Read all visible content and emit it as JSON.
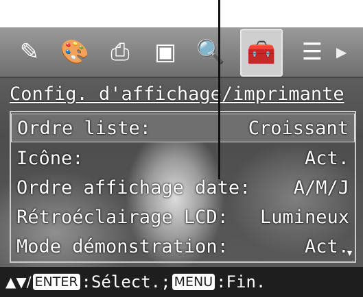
{
  "annotation": {
    "top_label": ""
  },
  "tabs": [
    {
      "icon": "edit-icon",
      "glyph": "✎",
      "active": false
    },
    {
      "icon": "palette-icon",
      "glyph": "🎨",
      "active": false
    },
    {
      "icon": "print-icon",
      "glyph": "⎙",
      "active": false
    },
    {
      "icon": "slideshow-icon",
      "glyph": "▣",
      "active": false
    },
    {
      "icon": "search-file-icon",
      "glyph": "🔍",
      "active": false
    },
    {
      "icon": "toolbox-icon",
      "glyph": "🧰",
      "active": true
    },
    {
      "icon": "list-icon",
      "glyph": "☰",
      "active": false
    }
  ],
  "tab_arrow": "▶",
  "menu": {
    "title": "Config. d'affichage/imprimante",
    "items": [
      {
        "label": "Ordre liste:",
        "value": "Croissant",
        "selected": true
      },
      {
        "label": "Icône:",
        "value": "Act.",
        "selected": false
      },
      {
        "label": "Ordre affichage date:",
        "value": "A/M/J",
        "selected": false
      },
      {
        "label": "Rétroéclairage LCD:",
        "value": "Lumineux",
        "selected": false
      },
      {
        "label": "Mode démonstration:",
        "value": "Act.",
        "selected": false
      }
    ],
    "scroll_indicator": "▾"
  },
  "bottom_bar": {
    "arrows": "▲▼/",
    "enter_key": "ENTER",
    "select_text": ":Sélect.; ",
    "menu_key": "MENU",
    "end_text": ":Fin."
  },
  "colors": {
    "selected_row": "#6f6f6f",
    "menu_border": "#cccccc",
    "bottom_bar": "#1e1e1e"
  }
}
